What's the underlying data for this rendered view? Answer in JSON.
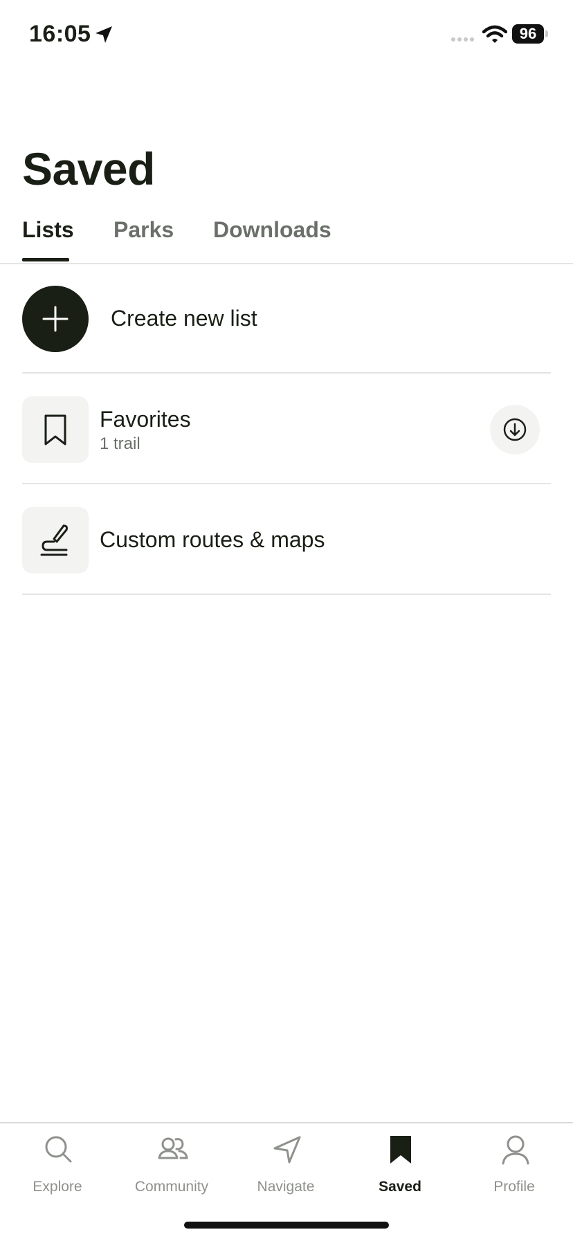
{
  "status": {
    "time": "16:05",
    "battery": "96"
  },
  "header": {
    "title": "Saved"
  },
  "tabs": [
    {
      "label": "Lists",
      "active": true
    },
    {
      "label": "Parks",
      "active": false
    },
    {
      "label": "Downloads",
      "active": false
    }
  ],
  "lists": {
    "create_label": "Create new list",
    "favorites": {
      "title": "Favorites",
      "subtitle": "1 trail",
      "icon": "bookmark-icon",
      "action_icon": "download-icon"
    },
    "custom": {
      "title": "Custom routes & maps",
      "icon": "route-pen-icon"
    }
  },
  "nav": [
    {
      "label": "Explore",
      "icon": "search-icon",
      "active": false
    },
    {
      "label": "Community",
      "icon": "people-icon",
      "active": false
    },
    {
      "label": "Navigate",
      "icon": "navigate-arrow-icon",
      "active": false
    },
    {
      "label": "Saved",
      "icon": "bookmark-filled-icon",
      "active": true
    },
    {
      "label": "Profile",
      "icon": "person-icon",
      "active": false
    }
  ],
  "colors": {
    "primary": "#1a1f16",
    "muted": "#6b6f6a",
    "tile": "#f3f3f2",
    "divider": "#e4e4e4"
  }
}
